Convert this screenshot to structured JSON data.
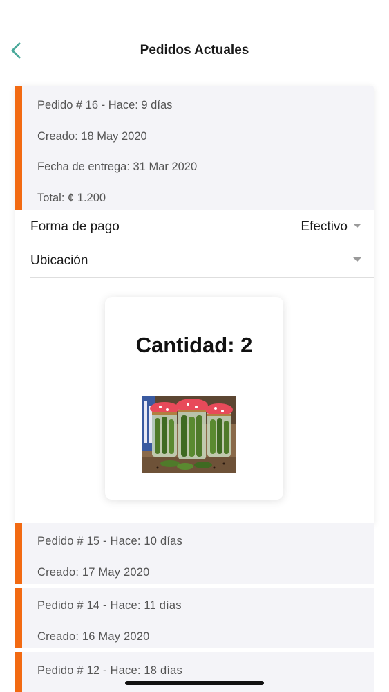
{
  "header": {
    "title": "Pedidos Actuales"
  },
  "expanded_order": {
    "line1": "Pedido # 16 - Hace: 9 días",
    "created": "Creado: 18 May 2020",
    "delivery": "Fecha de entrega: 31 Mar 2020",
    "total": "Total: ¢ 1.200",
    "payment_label": "Forma de pago",
    "payment_value": "Efectivo",
    "location_label": "Ubicación",
    "location_value": "",
    "quantity": "Cantidad: 2"
  },
  "orders": [
    {
      "line1": "Pedido # 15 - Hace: 10 días",
      "created": "Creado: 17 May 2020"
    },
    {
      "line1": "Pedido # 14 - Hace: 11 días",
      "created": "Creado: 16 May 2020"
    },
    {
      "line1": "Pedido # 12 - Hace: 18 días"
    }
  ],
  "colors": {
    "accent": "#f26a12",
    "back_arrow": "#4aa99a",
    "card_bg": "#f4f4f8"
  },
  "icons": {
    "back": "chevron-left-icon",
    "dropdown": "caret-down-icon"
  }
}
